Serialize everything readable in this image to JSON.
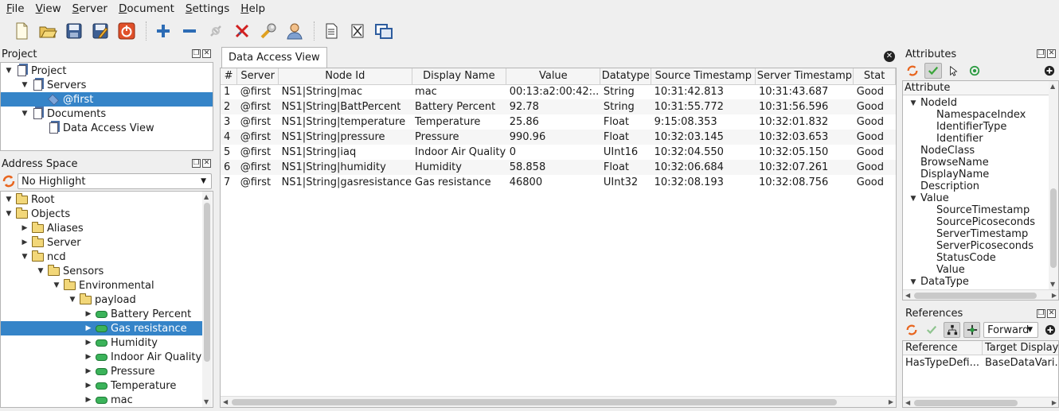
{
  "menu": [
    {
      "accel": "F",
      "rest": "ile"
    },
    {
      "accel": "V",
      "rest": "iew"
    },
    {
      "accel": "S",
      "rest": "erver"
    },
    {
      "accel": "D",
      "rest": "ocument"
    },
    {
      "accel": "S",
      "rest": "ettings"
    },
    {
      "accel": "H",
      "rest": "elp"
    }
  ],
  "toolbar_icons": [
    "new-file-icon",
    "open-folder-icon",
    "save-icon",
    "save-as-icon",
    "power-icon",
    "add-icon",
    "remove-icon",
    "connect-icon",
    "disconnect-icon",
    "settings-wrench-icon",
    "user-icon",
    "document-icon",
    "delete-document-icon",
    "window-icon"
  ],
  "project": {
    "title": "Project",
    "items": [
      {
        "label": "Project",
        "level": 0,
        "arrow": "▼",
        "icon": "doc",
        "selected": false
      },
      {
        "label": "Servers",
        "level": 1,
        "arrow": "▼",
        "icon": "doc",
        "selected": false
      },
      {
        "label": "@first",
        "level": 2,
        "arrow": "",
        "icon": "tag",
        "selected": true
      },
      {
        "label": "Documents",
        "level": 1,
        "arrow": "▼",
        "icon": "doc",
        "selected": false
      },
      {
        "label": "Data Access View",
        "level": 2,
        "arrow": "",
        "icon": "doc",
        "selected": false
      }
    ]
  },
  "address_space": {
    "title": "Address Space",
    "highlight_value": "No Highlight",
    "items": [
      {
        "label": "Root",
        "level": 0,
        "arrow": "▼",
        "icon": "folder",
        "selected": false
      },
      {
        "label": "Objects",
        "level": 0,
        "arrow": "▼",
        "icon": "folder",
        "selected": false
      },
      {
        "label": "Aliases",
        "level": 1,
        "arrow": "▶",
        "icon": "folder",
        "selected": false
      },
      {
        "label": "Server",
        "level": 1,
        "arrow": "▶",
        "icon": "folder",
        "selected": false
      },
      {
        "label": "ncd",
        "level": 1,
        "arrow": "▼",
        "icon": "folder",
        "selected": false
      },
      {
        "label": "Sensors",
        "level": 2,
        "arrow": "▼",
        "icon": "folder",
        "selected": false
      },
      {
        "label": "Environmental",
        "level": 3,
        "arrow": "▼",
        "icon": "folder",
        "selected": false
      },
      {
        "label": "payload",
        "level": 4,
        "arrow": "▼",
        "icon": "folder",
        "selected": false
      },
      {
        "label": "Battery Percent",
        "level": 5,
        "arrow": "▶",
        "icon": "var",
        "selected": false
      },
      {
        "label": "Gas resistance",
        "level": 5,
        "arrow": "▶",
        "icon": "var",
        "selected": true
      },
      {
        "label": "Humidity",
        "level": 5,
        "arrow": "▶",
        "icon": "var",
        "selected": false
      },
      {
        "label": "Indoor Air Quality",
        "level": 5,
        "arrow": "▶",
        "icon": "var",
        "selected": false
      },
      {
        "label": "Pressure",
        "level": 5,
        "arrow": "▶",
        "icon": "var",
        "selected": false
      },
      {
        "label": "Temperature",
        "level": 5,
        "arrow": "▶",
        "icon": "var",
        "selected": false
      },
      {
        "label": "mac",
        "level": 5,
        "arrow": "▶",
        "icon": "var",
        "selected": false
      }
    ]
  },
  "data_access_view": {
    "tab_label": "Data Access View",
    "columns": [
      "#",
      "Server",
      "Node Id",
      "Display Name",
      "Value",
      "Datatype",
      "Source Timestamp",
      "Server Timestamp",
      "Stat"
    ],
    "rows": [
      [
        "1",
        "@first",
        "NS1|String|mac",
        "mac",
        "00:13:a2:00:42:..",
        "String",
        "10:31:42.813",
        "10:31:43.687",
        "Good"
      ],
      [
        "2",
        "@first",
        "NS1|String|BattPercent",
        "Battery Percent",
        "92.78",
        "String",
        "10:31:55.772",
        "10:31:56.596",
        "Good"
      ],
      [
        "3",
        "@first",
        "NS1|String|temperature",
        "Temperature",
        "25.86",
        "Float",
        "9:15:08.353",
        "10:32:01.832",
        "Good"
      ],
      [
        "4",
        "@first",
        "NS1|String|pressure",
        "Pressure",
        "990.96",
        "Float",
        "10:32:03.145",
        "10:32:03.653",
        "Good"
      ],
      [
        "5",
        "@first",
        "NS1|String|iaq",
        "Indoor Air Quality",
        "0",
        "UInt16",
        "10:32:04.550",
        "10:32:05.150",
        "Good"
      ],
      [
        "6",
        "@first",
        "NS1|String|humidity",
        "Humidity",
        "58.858",
        "Float",
        "10:32:06.684",
        "10:32:07.261",
        "Good"
      ],
      [
        "7",
        "@first",
        "NS1|String|gasresistance",
        "Gas resistance",
        "46800",
        "UInt32",
        "10:32:08.193",
        "10:32:08.756",
        "Good"
      ]
    ]
  },
  "attributes": {
    "title": "Attributes",
    "header": "Attribute",
    "items": [
      {
        "label": "NodeId",
        "arrow": "▼",
        "level": 1
      },
      {
        "label": "NamespaceIndex",
        "arrow": "",
        "level": 2
      },
      {
        "label": "IdentifierType",
        "arrow": "",
        "level": 2
      },
      {
        "label": "Identifier",
        "arrow": "",
        "level": 2
      },
      {
        "label": "NodeClass",
        "arrow": "",
        "level": 1
      },
      {
        "label": "BrowseName",
        "arrow": "",
        "level": 1
      },
      {
        "label": "DisplayName",
        "arrow": "",
        "level": 1
      },
      {
        "label": "Description",
        "arrow": "",
        "level": 1
      },
      {
        "label": "Value",
        "arrow": "▼",
        "level": 1
      },
      {
        "label": "SourceTimestamp",
        "arrow": "",
        "level": 2
      },
      {
        "label": "SourcePicoseconds",
        "arrow": "",
        "level": 2
      },
      {
        "label": "ServerTimestamp",
        "arrow": "",
        "level": 2
      },
      {
        "label": "ServerPicoseconds",
        "arrow": "",
        "level": 2
      },
      {
        "label": "StatusCode",
        "arrow": "",
        "level": 2
      },
      {
        "label": "Value",
        "arrow": "",
        "level": 2
      },
      {
        "label": "DataType",
        "arrow": "▼",
        "level": 1
      }
    ]
  },
  "references": {
    "title": "References",
    "direction": "Forward",
    "columns": [
      "Reference",
      "Target DisplayN"
    ],
    "rows": [
      [
        "HasTypeDefi...",
        "BaseDataVari..."
      ]
    ]
  }
}
